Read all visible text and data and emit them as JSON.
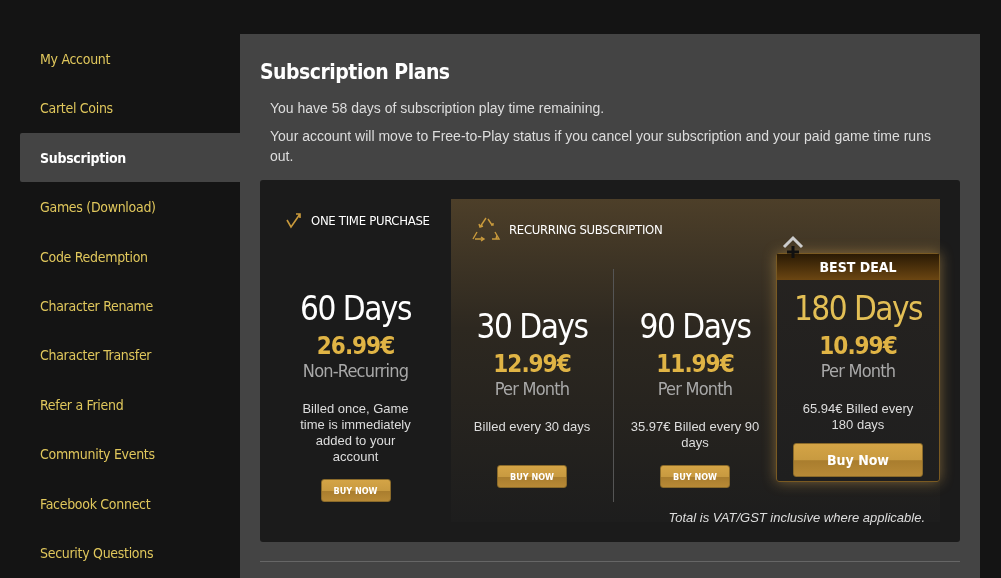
{
  "sidebar": {
    "items": [
      {
        "label": "My Account",
        "selected": false
      },
      {
        "label": "Cartel Coins",
        "selected": false
      },
      {
        "label": "Subscription",
        "selected": true
      },
      {
        "label": "Games (Download)",
        "selected": false
      },
      {
        "label": "Code Redemption",
        "selected": false
      },
      {
        "label": "Character Rename",
        "selected": false
      },
      {
        "label": "Character Transfer",
        "selected": false
      },
      {
        "label": "Refer a Friend",
        "selected": false
      },
      {
        "label": "Community Events",
        "selected": false
      },
      {
        "label": "Facebook Connect",
        "selected": false
      },
      {
        "label": "Security Questions",
        "selected": false
      }
    ]
  },
  "main": {
    "title": "Subscription Plans",
    "notices": [
      "You have 58 days of subscription play time remaining.",
      "Your account will move to Free-to-Play status if you cancel your subscription and your paid game time runs out."
    ],
    "groups": [
      {
        "kind": "one_time",
        "heading": "ONE TIME PURCHASE",
        "plans": [
          {
            "duration": "60 Days",
            "price": "26.99€",
            "period": "Non-Recurring",
            "billing": "Billed once, Game time is immediately added to your account",
            "button": "BUY NOW",
            "featured": false
          }
        ]
      },
      {
        "kind": "recurring",
        "heading": "RECURRING SUBSCRIPTION",
        "plans": [
          {
            "duration": "30 Days",
            "price": "12.99€",
            "period": "Per Month",
            "billing": "Billed every 30 days",
            "button": "BUY NOW",
            "featured": false
          },
          {
            "duration": "90 Days",
            "price": "11.99€",
            "period": "Per Month",
            "billing": "35.97€ Billed every 90 days",
            "button": "BUY NOW",
            "featured": false
          },
          {
            "duration": "180 Days",
            "price": "10.99€",
            "period": "Per Month",
            "billing": "65.94€ Billed every 180 days",
            "button": "Buy Now",
            "featured": true,
            "badge": "BEST DEAL"
          }
        ]
      }
    ],
    "footnote": "Total is VAT/GST inclusive where applicable."
  }
}
